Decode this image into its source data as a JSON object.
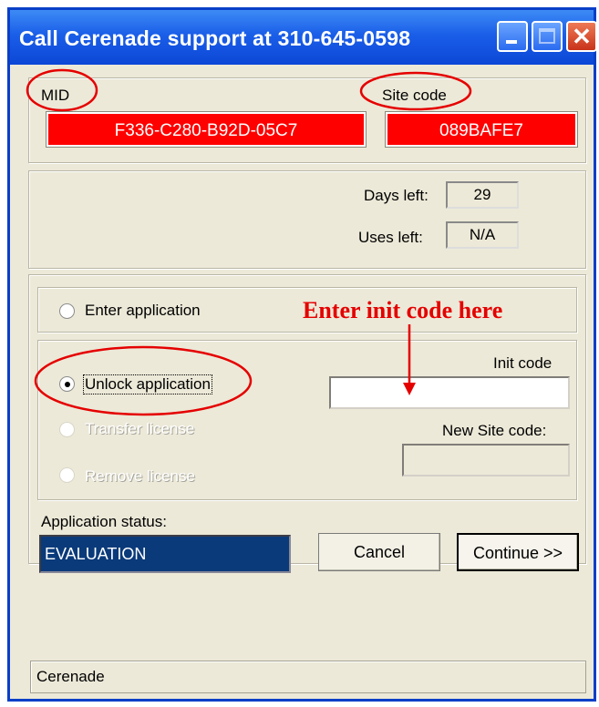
{
  "window": {
    "title": "Call Cerenade support at 310-645-0598"
  },
  "ids": {
    "mid_label": "MID",
    "mid_value": "F336-C280-B92D-05C7",
    "site_code_label": "Site code",
    "site_code_value": "089BAFE7"
  },
  "counters": {
    "days_left_label": "Days left:",
    "days_left_value": "29",
    "uses_left_label": "Uses left:",
    "uses_left_value": "N/A"
  },
  "options": {
    "enter_application": "Enter application",
    "unlock_application": "Unlock application",
    "transfer_license": "Transfer license",
    "remove_license": "Remove license",
    "selected": "unlock_application"
  },
  "unlock": {
    "init_code_label": "Init code",
    "init_code_value": "",
    "new_site_code_label": "New Site code:",
    "new_site_code_value": ""
  },
  "status": {
    "label": "Application status:",
    "value": "EVALUATION"
  },
  "buttons": {
    "cancel": "Cancel",
    "continue": "Continue >>"
  },
  "statusbar": {
    "text": "Cerenade"
  },
  "annotation": {
    "text": "Enter init code here",
    "color": "#e50000"
  },
  "colors": {
    "titlebar": "#1a5ee8",
    "field_red": "#ff0000",
    "status_field": "#0a3a7a",
    "window_bg": "#ece9d8"
  }
}
